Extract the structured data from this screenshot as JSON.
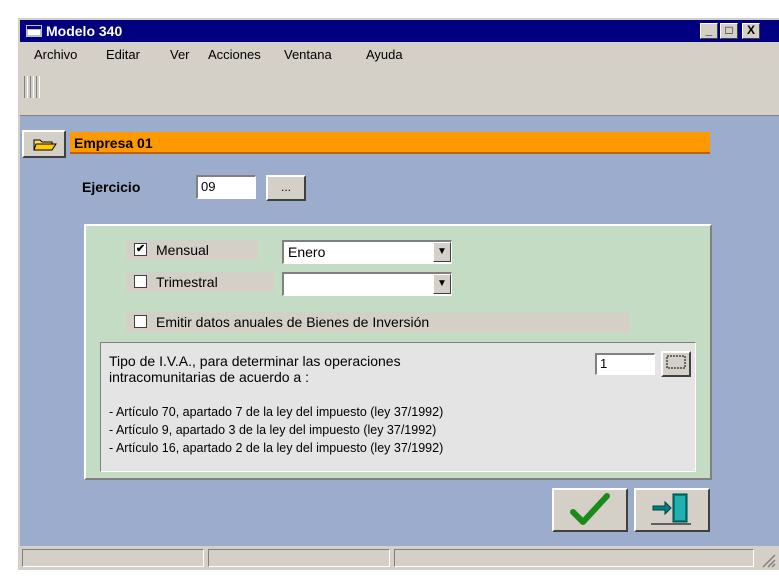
{
  "window": {
    "title": "Modelo 340",
    "minimize": "_",
    "maximize": "□",
    "close": "X"
  },
  "menu": [
    "Archivo",
    "Editar",
    "Ver",
    "Acciones",
    "Ventana",
    "Ayuda"
  ],
  "header": {
    "title": "Empresa 01"
  },
  "ejercicio": {
    "label": "Ejercicio",
    "value": "09",
    "browse_label": "..."
  },
  "periodo": {
    "mensual": {
      "label": "Mensual",
      "checked": true,
      "value": "Enero"
    },
    "trimestral": {
      "label": "Trimestral",
      "checked": false,
      "value": ""
    },
    "bienes": {
      "label": "Emitir datos anuales de Bienes de Inversión",
      "checked": false
    }
  },
  "iva": {
    "text_line1": "Tipo de I.V.A., para determinar las operaciones",
    "text_line2": "intracomunitarias de acuerdo a :",
    "value": "1",
    "articulos": [
      "- Artículo 70, apartado 7 de la ley del impuesto (ley 37/1992)",
      "- Artículo 9, apartado 3 de la ley del impuesto (ley 37/1992)",
      "- Artículo 16, apartado 2 de la ley del impuesto (ley 37/1992)"
    ]
  },
  "colors": {
    "titlebar": "#000080",
    "header_bar": "#ff9900",
    "background": "#9caccc",
    "panel": "#c4dcc4",
    "ok_check": "#1a8a1a",
    "exit_icon": "#008080"
  },
  "icons": {
    "app": "app-icon",
    "folder": "open-folder-icon",
    "ok": "checkmark-icon",
    "exit": "exit-door-icon"
  }
}
